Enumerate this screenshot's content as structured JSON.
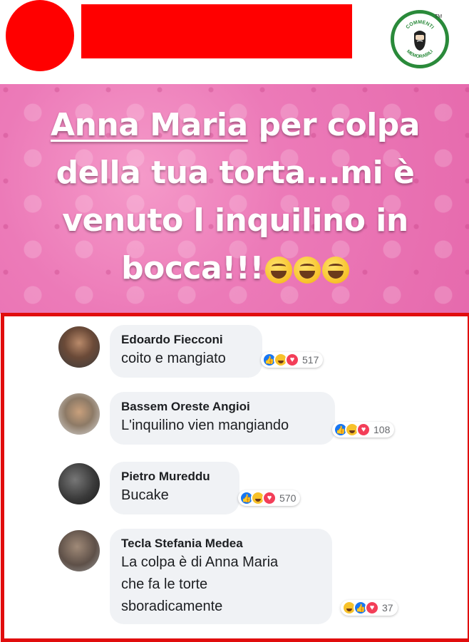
{
  "header": {
    "logo": {
      "line_top": "COMMENTI",
      "line_bottom": "MEMORABILI",
      "tm": "TM",
      "icon": "bearded-man-icon",
      "color": "#2a8a3a"
    }
  },
  "meme": {
    "line1_name": "Anna Maria",
    "line1_rest": " per colpa",
    "line2": "della tua torta...mi è",
    "line3": "venuto l inquilino in",
    "line4": "bocca!!!",
    "emoji": "laughing-tears-icon",
    "background_color": "#ec7ab8"
  },
  "comments": [
    {
      "author": "Edoardo Fiecconi",
      "text_lines": [
        "coito e mangiato"
      ],
      "reactions": [
        "like",
        "haha",
        "love"
      ],
      "count": "517"
    },
    {
      "author": "Bassem Oreste Angioi",
      "text_lines": [
        "L'inquilino vien mangiando"
      ],
      "reactions": [
        "like",
        "haha",
        "love"
      ],
      "count": "108"
    },
    {
      "author": "Pietro Mureddu",
      "text_lines": [
        "Bucake"
      ],
      "reactions": [
        "like",
        "haha",
        "love"
      ],
      "count": "570"
    },
    {
      "author": "Tecla Stefania Medea",
      "text_lines": [
        "La colpa è di Anna Maria",
        "che fa le torte",
        "sboradicamente"
      ],
      "reactions": [
        "haha",
        "like",
        "love"
      ],
      "count": "37"
    }
  ],
  "colors": {
    "highlight_border": "#e10d0d",
    "redaction": "#ff0000",
    "bubble": "#f0f2f5"
  }
}
